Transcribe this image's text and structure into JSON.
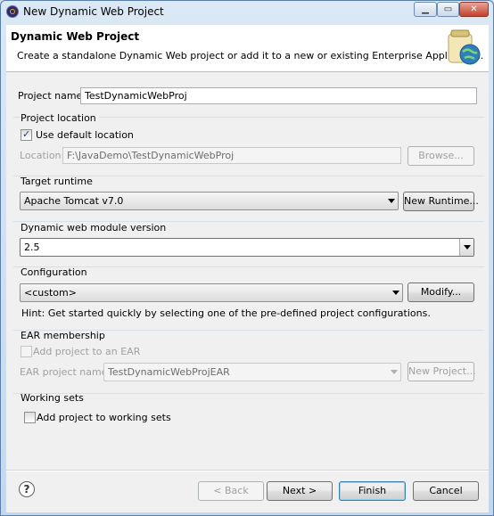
{
  "window": {
    "title": "New Dynamic Web Project",
    "minimize_glyph": "▁",
    "maximize_glyph": "▭",
    "close_glyph": "✕"
  },
  "banner": {
    "title": "Dynamic Web Project",
    "description": "Create a standalone Dynamic Web project or add it to a new or existing Enterprise Application."
  },
  "project_name": {
    "label": "Project name:",
    "value": "TestDynamicWebProj"
  },
  "project_location": {
    "heading": "Project location",
    "use_default_label": "Use default location",
    "use_default_checked": true,
    "location_label": "Location:",
    "location_value": "F:\\JavaDemo\\TestDynamicWebProj",
    "browse_label": "Browse..."
  },
  "target_runtime": {
    "heading": "Target runtime",
    "selected": "Apache Tomcat v7.0",
    "new_runtime_label": "New Runtime..."
  },
  "module_version": {
    "heading": "Dynamic web module version",
    "selected": "2.5"
  },
  "configuration": {
    "heading": "Configuration",
    "selected": "<custom>",
    "modify_label": "Modify...",
    "hint": "Hint: Get started quickly by selecting one of the pre-defined project configurations."
  },
  "ear": {
    "heading": "EAR membership",
    "add_label": "Add project to an EAR",
    "add_checked": false,
    "project_name_label": "EAR project name:",
    "project_name_value": "TestDynamicWebProjEAR",
    "new_project_label": "New Project..."
  },
  "working_sets": {
    "heading": "Working sets",
    "add_label": "Add project to working sets",
    "add_checked": false
  },
  "footer": {
    "help_glyph": "?",
    "back_label": "< Back",
    "next_label": "Next >",
    "finish_label": "Finish",
    "cancel_label": "Cancel"
  },
  "icons": {
    "app": "eclipse-icon",
    "banner": "web-project-jar-globe-icon",
    "help": "help-icon"
  }
}
